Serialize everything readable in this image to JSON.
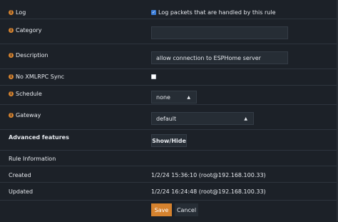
{
  "fields": {
    "log": {
      "label": "Log",
      "checked": true,
      "checkbox_label": "Log packets that are handled by this rule"
    },
    "category": {
      "label": "Category",
      "value": ""
    },
    "description": {
      "label": "Description",
      "value": "allow connection to ESPHome server"
    },
    "no_xmlrpc_sync": {
      "label": "No XMLRPC Sync",
      "checked": false
    },
    "schedule": {
      "label": "Schedule",
      "value": "none"
    },
    "gateway": {
      "label": "Gateway",
      "value": "default"
    },
    "advanced": {
      "label": "Advanced features",
      "button_label": "Show/Hide"
    },
    "rule_information": {
      "label": "Rule Information"
    },
    "created": {
      "label": "Created",
      "value": "1/2/24 15:36:10 (root@192.168.100.33)"
    },
    "updated": {
      "label": "Updated",
      "value": "1/2/24 16:24:48 (root@192.168.100.33)"
    }
  },
  "actions": {
    "save_label": "Save",
    "cancel_label": "Cancel"
  },
  "icons": {
    "info": "info-icon",
    "caret": "caret-icon",
    "check": "check-icon"
  },
  "colors": {
    "accent": "#d5822e",
    "checkbox": "#3b7dd8",
    "background": "#1c2128"
  }
}
